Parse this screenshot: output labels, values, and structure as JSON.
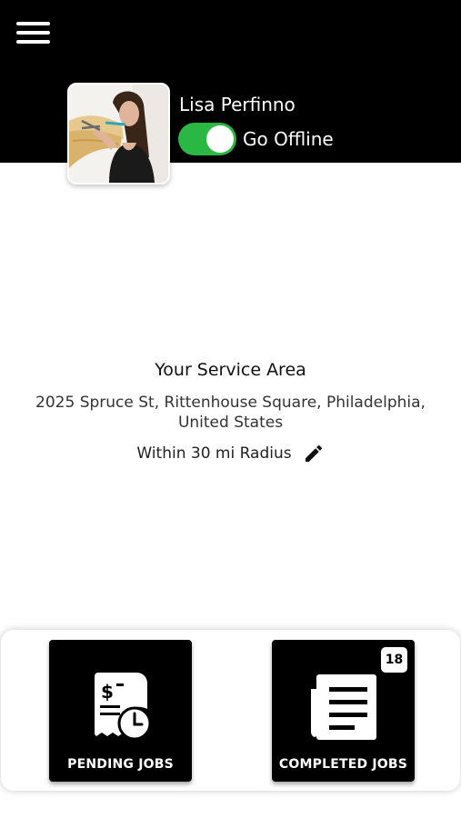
{
  "header": {
    "menu_icon": "hamburger-menu-icon",
    "user_name": "Lisa Perfinno",
    "status_toggle": {
      "on": true,
      "label": "Go Offline",
      "color": "#2bb744"
    }
  },
  "service_area": {
    "title": "Your Service Area",
    "address": "2025 Spruce St, Rittenhouse Square, Philadelphia, United States",
    "radius": "Within 30 mi Radius",
    "edit_icon": "pencil-icon"
  },
  "bottom_nav": {
    "pending": {
      "label": "PENDING JOBS",
      "icon": "receipt-clock-icon"
    },
    "completed": {
      "label": "COMPLETED JOBS",
      "icon": "document-list-icon",
      "badge": "18"
    }
  }
}
